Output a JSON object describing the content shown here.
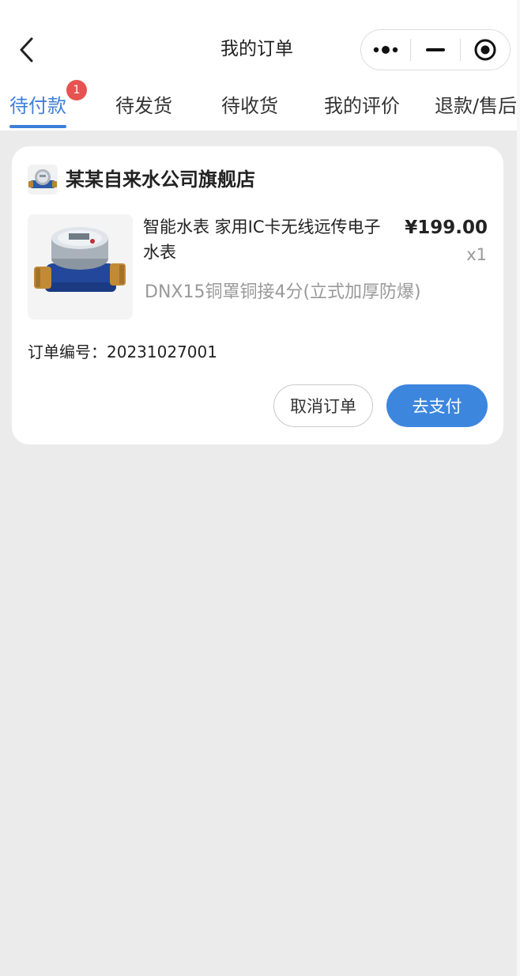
{
  "header": {
    "title": "我的订单",
    "back_icon": "chevron-left-icon",
    "capsule": {
      "more_icon": "more-dots-icon",
      "minimize_icon": "minimize-icon",
      "close_icon": "target-circle-icon"
    }
  },
  "tabs": [
    {
      "label": "待付款",
      "active": true,
      "badge": "1"
    },
    {
      "label": "待发货",
      "active": false
    },
    {
      "label": "待收货",
      "active": false
    },
    {
      "label": "我的评价",
      "active": false
    },
    {
      "label": "退款/售后",
      "active": false
    }
  ],
  "order": {
    "shop_name": "某某自来水公司旗舰店",
    "product": {
      "name": "智能水表 家用IC卡无线远传电子水表",
      "price": "¥199.00",
      "quantity": "x1",
      "spec": "DNX15铜罩铜接4分(立式加厚防爆)"
    },
    "order_number_label": "订单编号：20231027001",
    "cancel_label": "取消订单",
    "pay_label": "去支付"
  },
  "colors": {
    "accent": "#3d7fd9",
    "pay_button": "#3d86de",
    "badge": "#e65350",
    "background": "#ebebeb"
  }
}
